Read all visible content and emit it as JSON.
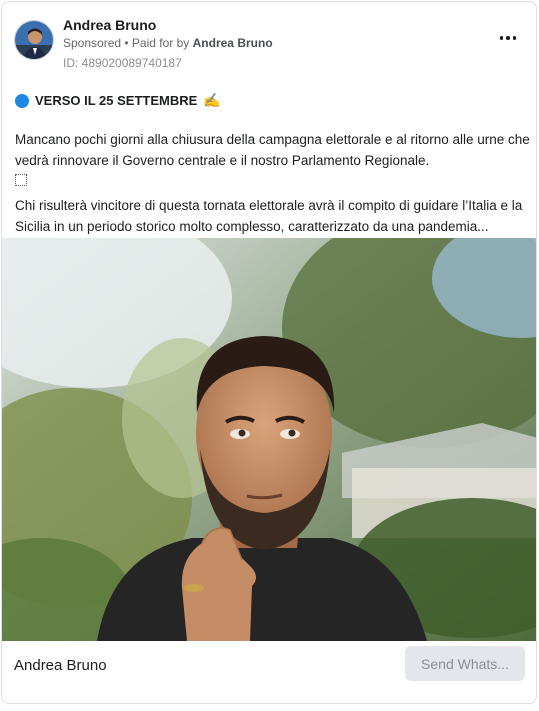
{
  "advertiser": {
    "name": "Andrea Bruno",
    "sponsored_label": "Sponsored",
    "separator": " • ",
    "paid_for_label": "Paid for by",
    "paid_for_name": "Andrea Bruno",
    "id_label": "ID: 489020089740187"
  },
  "icons": {
    "more": "more-options-icon",
    "headline_bullet": "blue-circle-icon",
    "headline_emoji": "writing-hand-icon"
  },
  "post": {
    "headline": "VERSO IL 25 SETTEMBRE",
    "headline_emoji": "✍️",
    "paragraph1": "Mancano pochi giorni alla chiusura della campagna elettorale e al ritorno alle urne che vedrà rinnovare il Governo centrale e il nostro Parlamento Regionale.",
    "paragraph2": "Chi risulterà vincitore di questa tornata elettorale avrà il compito di guidare l’Italia e la Sicilia in un periodo storico molto complesso, caratterizzato da una pandemia..."
  },
  "footer": {
    "name": "Andrea Bruno",
    "cta_label": "Send Whats..."
  },
  "colors": {
    "accent": "#1e88e5",
    "cta_bg": "#e4e6eb",
    "muted_text": "#65676b"
  }
}
